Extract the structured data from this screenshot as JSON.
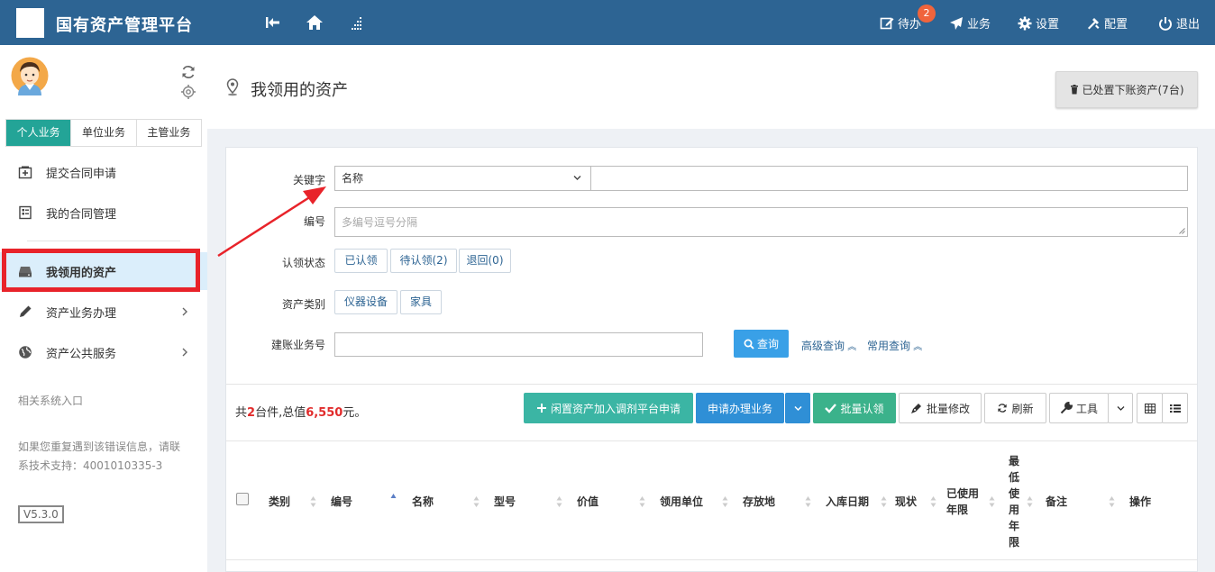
{
  "header": {
    "app_title": "国有资产管理平台",
    "todo_label": "待办",
    "todo_count": "2",
    "business_label": "业务",
    "settings_label": "设置",
    "config_label": "配置",
    "logout_label": "退出"
  },
  "sidebar": {
    "tabs": [
      "个人业务",
      "单位业务",
      "主管业务"
    ],
    "menu": [
      {
        "label": "提交合同申请",
        "icon": "add-document-icon"
      },
      {
        "label": "我的合同管理",
        "icon": "list-document-icon"
      },
      {
        "label": "我领用的资产",
        "icon": "drive-icon"
      },
      {
        "label": "资产业务办理",
        "icon": "pencil-icon"
      },
      {
        "label": "资产公共服务",
        "icon": "globe-icon"
      }
    ],
    "related_title": "相关系统入口",
    "support_line1": "如果您重复遇到该错误信息，请联",
    "support_line2": "系技术支持：4001010335-3",
    "version": "V5.3.0"
  },
  "page": {
    "title": "我领用的资产",
    "disposed_button": "已处置下账资产(7台)"
  },
  "filters": {
    "keyword_label": "关键字",
    "keyword_select": "名称",
    "number_label": "编号",
    "number_placeholder": "多编号逗号分隔",
    "claim_status_label": "认领状态",
    "claim_status_options": [
      "已认领",
      "待认领(2)",
      "退回(0)"
    ],
    "category_label": "资产类别",
    "category_options": [
      "仪器设备",
      "家具"
    ],
    "bill_label": "建账业务号",
    "query_button": "查询",
    "advanced_query": "高级查询",
    "common_query": "常用查询"
  },
  "toolbar": {
    "summary_prefix": "共",
    "summary_count": "2",
    "summary_mid": "台件,总值",
    "summary_value": "6,550",
    "summary_suffix": "元。",
    "idle_button": "闲置资产加入调剂平台申请",
    "apply_button": "申请办理业务",
    "batch_confirm": "批量认领",
    "batch_edit": "批量修改",
    "refresh": "刷新",
    "tools": "工具"
  },
  "table": {
    "columns": [
      "类别",
      "编号",
      "名称",
      "型号",
      "价值",
      "领用单位",
      "存放地",
      "入库日期",
      "现状",
      "已使用\n年限",
      "最\n低\n使\n用\n年\n限",
      "备注",
      "操作"
    ]
  },
  "colors": {
    "header_bg": "#2d6493",
    "tab_active": "#23a497",
    "badge": "#f0643c",
    "highlight_box": "#e8232a",
    "annotation_arrow": "#e8232a"
  }
}
